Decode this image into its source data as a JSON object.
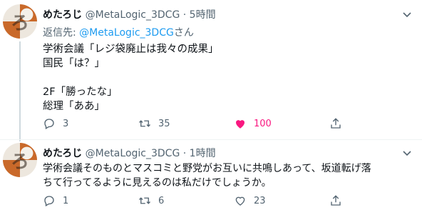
{
  "tweets": [
    {
      "name": "めたろじ",
      "handle": "@MetaLogic_3DCG",
      "sep": "·",
      "time": "5時間",
      "reply_prefix": "返信先: ",
      "reply_mention": "@MetaLogic_3DCG",
      "reply_suffix": "さん",
      "lines": [
        "学術会議「レジ袋廃止は我々の成果」",
        "国民「は？」",
        "",
        "2F「勝ったな」",
        "総理「ああ」"
      ],
      "replies": "3",
      "retweets": "35",
      "likes": "100",
      "liked": true
    },
    {
      "name": "めたろじ",
      "handle": "@MetaLogic_3DCG",
      "sep": "·",
      "time": "1時間",
      "lines": [
        "学術会議そのものとマスコミと野党がお互いに共鳴しあって、坂道転げ落",
        "ちて行ってるように見えるのは私だけでしょうか。"
      ],
      "replies": "1",
      "retweets": "6",
      "likes": "23",
      "liked": false
    }
  ],
  "colors": {
    "like": "#f91880",
    "link": "#1d9bf0",
    "muted": "#536471"
  },
  "icons": [
    "reply-icon",
    "retweet-icon",
    "like-icon",
    "more-icon"
  ]
}
